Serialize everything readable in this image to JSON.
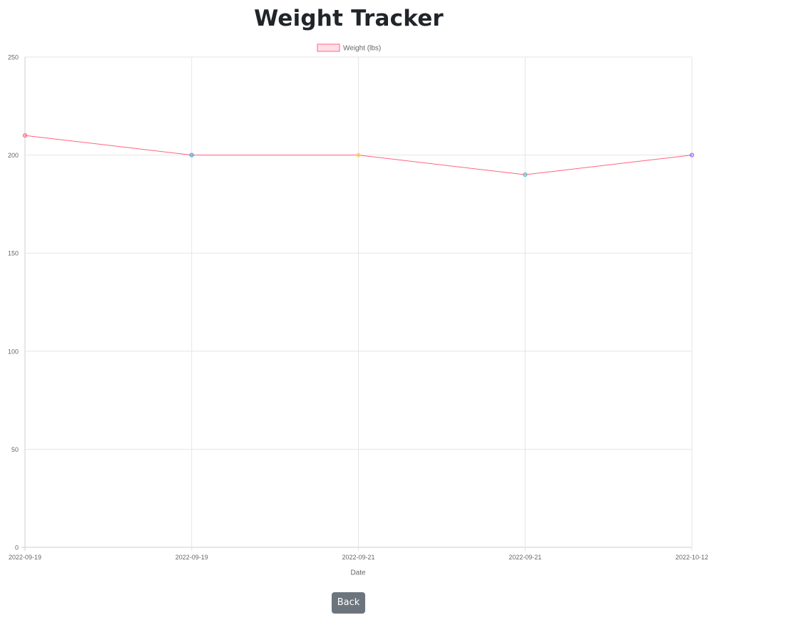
{
  "page": {
    "title": "Weight Tracker",
    "back_label": "Back"
  },
  "colors": {
    "line": "#ff6384",
    "legend_fill": "#ffe0e6",
    "grid": "#e5e5e5",
    "axis": "#cfcfcf",
    "tick_text": "#666666",
    "button_bg": "#6c757d",
    "point_colors": [
      "#ff6384",
      "#36a2eb",
      "#ffcd56",
      "#4bc0c0",
      "#9966ff"
    ]
  },
  "chart_data": {
    "type": "line",
    "categories": [
      "2022-09-19",
      "2022-09-19",
      "2022-09-21",
      "2022-09-21",
      "2022-10-12"
    ],
    "series": [
      {
        "name": "Weight (lbs)",
        "values": [
          210,
          200,
          200,
          190,
          200
        ]
      }
    ],
    "xlabel": "Date",
    "ylabel": "",
    "ylim": [
      0,
      250
    ],
    "yticks": [
      0,
      50,
      100,
      150,
      200,
      250
    ],
    "grid": true,
    "legend": "top-center"
  }
}
